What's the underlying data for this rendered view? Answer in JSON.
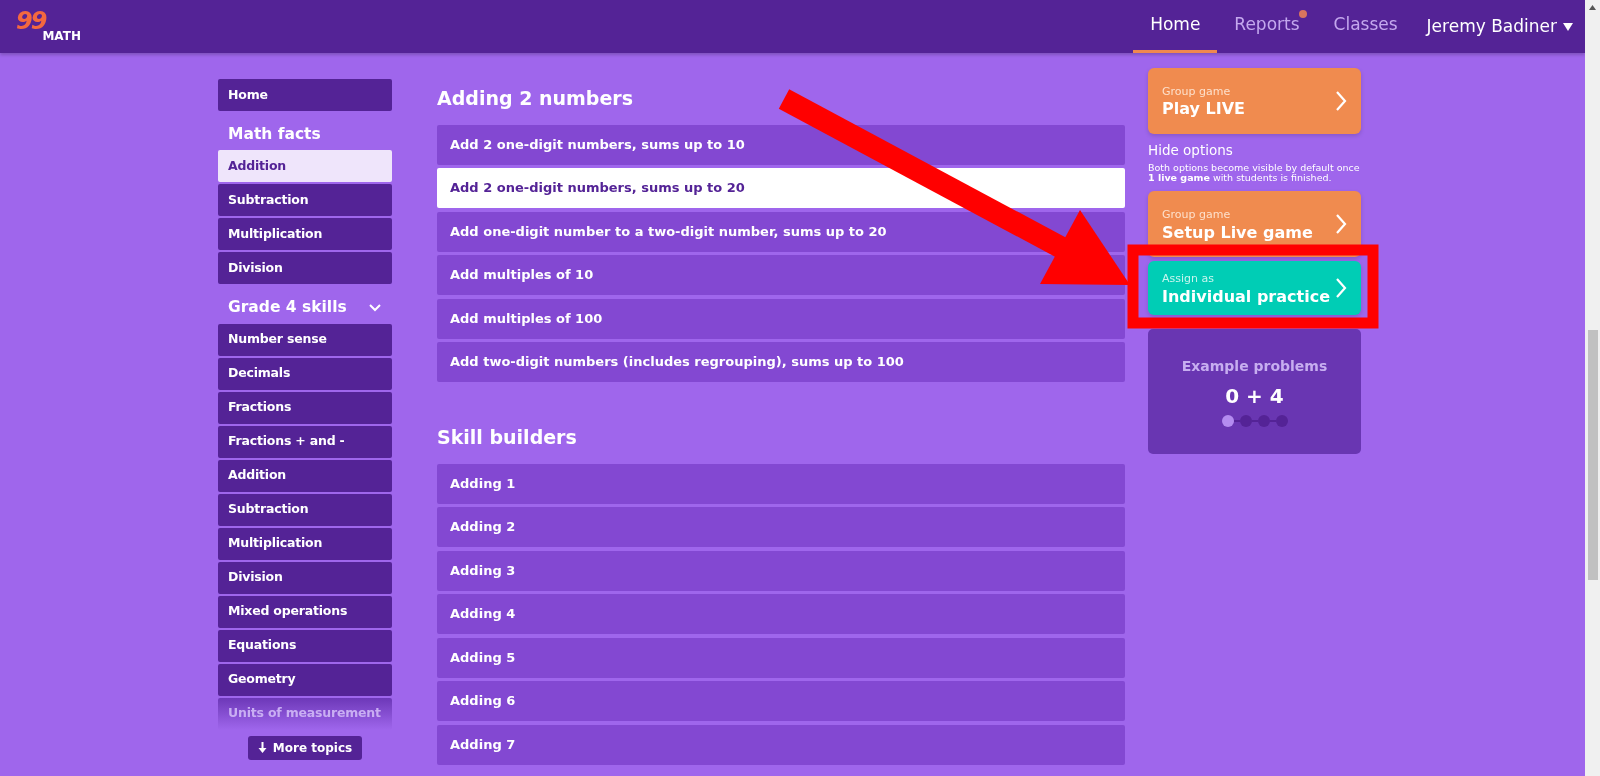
{
  "logo": {
    "digits": "99",
    "word": "MATH"
  },
  "nav": [
    {
      "label": "Home",
      "selected": true,
      "notification": false
    },
    {
      "label": "Reports",
      "selected": false,
      "notification": true
    },
    {
      "label": "Classes",
      "selected": false,
      "notification": false
    }
  ],
  "user": {
    "name": "Jeremy Badiner"
  },
  "sidebar": {
    "items": [
      {
        "kind": "item",
        "label": "Home",
        "selected": false
      },
      {
        "kind": "heading",
        "label": "Math facts"
      },
      {
        "kind": "item",
        "label": "Addition",
        "selected": true
      },
      {
        "kind": "item",
        "label": "Subtraction",
        "selected": false
      },
      {
        "kind": "item",
        "label": "Multiplication",
        "selected": false
      },
      {
        "kind": "item",
        "label": "Division",
        "selected": false
      },
      {
        "kind": "heading",
        "label": "Grade 4 skills",
        "expanded": true
      },
      {
        "kind": "item",
        "label": "Number sense",
        "selected": false
      },
      {
        "kind": "item",
        "label": "Decimals",
        "selected": false
      },
      {
        "kind": "item",
        "label": "Fractions",
        "selected": false
      },
      {
        "kind": "item",
        "label": "Fractions + and -",
        "selected": false
      },
      {
        "kind": "item",
        "label": "Addition",
        "selected": false
      },
      {
        "kind": "item",
        "label": "Subtraction",
        "selected": false
      },
      {
        "kind": "item",
        "label": "Multiplication",
        "selected": false
      },
      {
        "kind": "item",
        "label": "Division",
        "selected": false
      },
      {
        "kind": "item",
        "label": "Mixed operations",
        "selected": false
      },
      {
        "kind": "item",
        "label": "Equations",
        "selected": false
      },
      {
        "kind": "item",
        "label": "Geometry",
        "selected": false
      },
      {
        "kind": "item",
        "label": "Units of measurement",
        "selected": false
      }
    ],
    "more_button": "More topics"
  },
  "sections": [
    {
      "title": "Adding 2 numbers",
      "rows": [
        {
          "label": "Add 2 one-digit numbers, sums up to 10",
          "selected": false
        },
        {
          "label": "Add 2 one-digit numbers, sums up to 20",
          "selected": true
        },
        {
          "label": "Add one-digit number to a two-digit number, sums up to 20",
          "selected": false
        },
        {
          "label": "Add multiples of 10",
          "selected": false
        },
        {
          "label": "Add multiples of 100",
          "selected": false
        },
        {
          "label": "Add two-digit numbers (includes regrouping), sums up to 100",
          "selected": false
        }
      ]
    },
    {
      "title": "Skill builders",
      "rows": [
        {
          "label": "Adding 1",
          "selected": false
        },
        {
          "label": "Adding 2",
          "selected": false
        },
        {
          "label": "Adding 3",
          "selected": false
        },
        {
          "label": "Adding 4",
          "selected": false
        },
        {
          "label": "Adding 5",
          "selected": false
        },
        {
          "label": "Adding 6",
          "selected": false
        },
        {
          "label": "Adding 7",
          "selected": false
        }
      ]
    }
  ],
  "actions": [
    {
      "kind": "orange",
      "small": "Group game",
      "big": "Play LIVE"
    },
    {
      "kind": "options",
      "link": "Hide options",
      "note": "Both options become visible by default once **1 live game** with students is finished."
    },
    {
      "kind": "orange",
      "small": "Group game",
      "big": "Setup Live game"
    },
    {
      "kind": "teal",
      "small": "Assign as",
      "big": "Individual practice"
    }
  ],
  "example": {
    "title": "Example problems",
    "problem": "0 + 4",
    "dots": [
      {
        "selected": true
      },
      {
        "selected": false
      },
      {
        "selected": false
      },
      {
        "selected": false
      }
    ]
  }
}
